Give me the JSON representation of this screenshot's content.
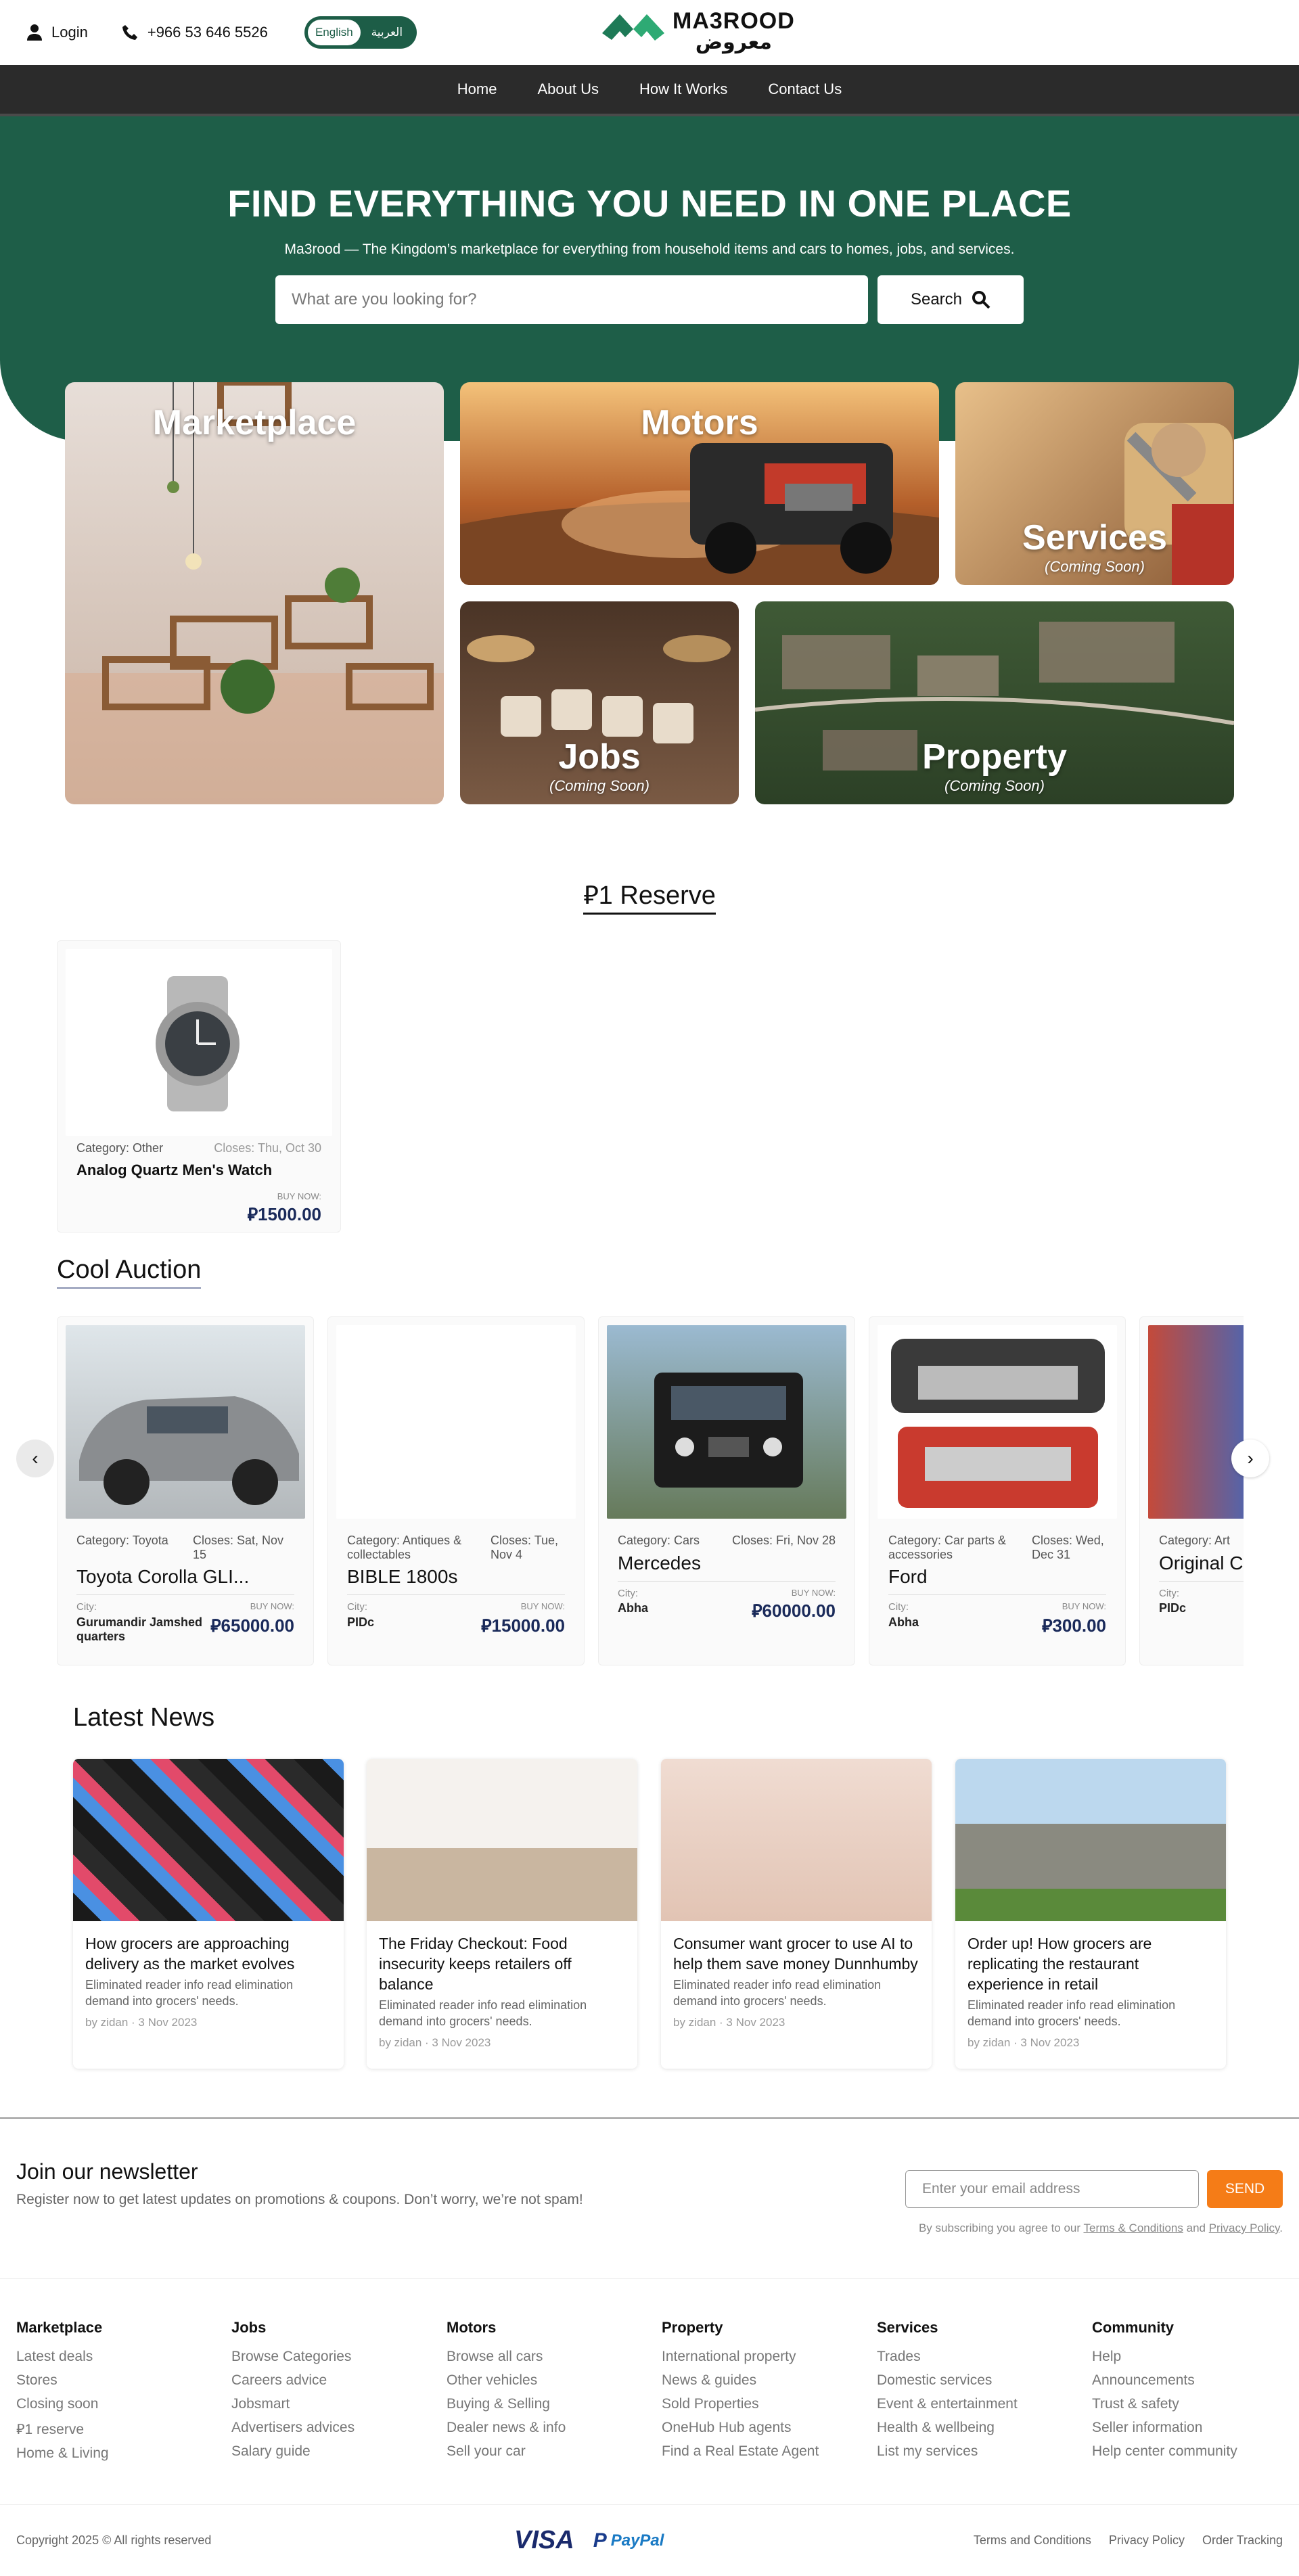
{
  "topbar": {
    "login": "Login",
    "phone": "+966 53 646 5526",
    "lang_en": "English",
    "lang_ar": "العربية",
    "logo_en": "MA3ROOD",
    "logo_ar": "معروض"
  },
  "nav": [
    "Home",
    "About Us",
    "How It Works",
    "Contact Us"
  ],
  "hero": {
    "title": "FIND EVERYTHING YOU NEED IN ONE PLACE",
    "subtitle": "Ma3rood — The Kingdom’s marketplace for everything from household items and cars to homes, jobs, and services.",
    "search_placeholder": "What are you looking for?",
    "search_button": "Search"
  },
  "categories": [
    {
      "title": "Marketplace",
      "sub": ""
    },
    {
      "title": "Motors",
      "sub": ""
    },
    {
      "title": "Services",
      "sub": "(Coming Soon)"
    },
    {
      "title": "Jobs",
      "sub": "(Coming Soon)"
    },
    {
      "title": "Property",
      "sub": "(Coming Soon)"
    }
  ],
  "currency_symbol": "⃁",
  "reserve": {
    "title": "⃁1 Reserve",
    "item": {
      "category": "Category: Other",
      "closes": "Closes: Thu, Oct 30",
      "name": "Analog Quartz Men's Watch",
      "buy_now": "BUY NOW:",
      "price": "⃁1500.00"
    }
  },
  "auction": {
    "title": "Cool Auction",
    "items": [
      {
        "category": "Category: Toyota",
        "closes": "Closes: Sat, Nov 15",
        "name": "Toyota Corolla GLI...",
        "city_label": "City:",
        "city": "Gurumandir Jamshed quarters",
        "buy_now": "BUY NOW:",
        "price": "⃁65000.00"
      },
      {
        "category": "Category: Antiques & collectables",
        "closes": "Closes: Tue, Nov 4",
        "name": "BIBLE 1800s",
        "city_label": "City:",
        "city": "PIDc",
        "buy_now": "BUY NOW:",
        "price": "⃁15000.00"
      },
      {
        "category": "Category: Cars",
        "closes": "Closes: Fri, Nov 28",
        "name": "Mercedes",
        "city_label": "City:",
        "city": "Abha",
        "buy_now": "BUY NOW:",
        "price": "⃁60000.00"
      },
      {
        "category": "Category: Car parts & accessories",
        "closes": "Closes: Wed, Dec 31",
        "name": "Ford",
        "city_label": "City:",
        "city": "Abha",
        "buy_now": "BUY NOW:",
        "price": "⃁300.00"
      },
      {
        "category": "Category: Art",
        "closes": "",
        "name": "Original C",
        "city_label": "City:",
        "city": "PIDc",
        "buy_now": "",
        "price": ""
      }
    ]
  },
  "news": {
    "title": "Latest News",
    "items": [
      {
        "title": "How grocers are approaching delivery as the market evolves",
        "desc": "Eliminated reader info read elimination demand into grocers' needs.",
        "by": "by zidan · 3 Nov 2023"
      },
      {
        "title": "The Friday Checkout: Food insecurity keeps retailers off balance",
        "desc": "Eliminated reader info read elimination demand into grocers' needs.",
        "by": "by zidan · 3 Nov 2023"
      },
      {
        "title": "Consumer want grocer to use AI to help them save money Dunnhumby",
        "desc": "Eliminated reader info read elimination demand into grocers' needs.",
        "by": "by zidan · 3 Nov 2023"
      },
      {
        "title": "Order up! How grocers are replicating the restaurant experience in retail",
        "desc": "Eliminated reader info read elimination demand into grocers' needs.",
        "by": "by zidan · 3 Nov 2023"
      }
    ]
  },
  "newsletter": {
    "title": "Join our newsletter",
    "desc": "Register now to get latest updates on promotions & coupons. Don’t worry, we’re not spam!",
    "placeholder": "Enter your email address",
    "button": "SEND",
    "terms_prefix": "By subscribing you agree to our",
    "terms_link": "Terms & Conditions",
    "and": "and",
    "privacy_link": "Privacy Policy"
  },
  "footer": {
    "cols": [
      {
        "title": "Marketplace",
        "links": [
          "Latest deals",
          "Stores",
          "Closing soon",
          "⃁1 reserve",
          "Home & Living"
        ]
      },
      {
        "title": "Jobs",
        "links": [
          "Browse Categories",
          "Careers advice",
          "Jobsmart",
          "Advertisers advices",
          "Salary guide"
        ]
      },
      {
        "title": "Motors",
        "links": [
          "Browse all cars",
          "Other vehicles",
          "Buying & Selling",
          "Dealer news & info",
          "Sell your car"
        ]
      },
      {
        "title": "Property",
        "links": [
          "International property",
          "News & guides",
          "Sold Properties",
          "OneHub Hub agents",
          "Find a Real Estate Agent"
        ]
      },
      {
        "title": "Services",
        "links": [
          "Trades",
          "Domestic services",
          "Event & entertainment",
          "Health & wellbeing",
          "List my services"
        ]
      },
      {
        "title": "Community",
        "links": [
          "Help",
          "Announcements",
          "Trust & safety",
          "Seller information",
          "Help center community"
        ]
      }
    ],
    "copyright": "Copyright 2025 © All rights reserved",
    "visa": "VISA",
    "paypal": "PayPal",
    "terms": "Terms and Conditions",
    "privacy": "Privacy Policy",
    "tracking": "Order Tracking"
  },
  "colors": {
    "brand_green": "#1e5e48",
    "nav_bg": "#2b2b2b",
    "send_orange": "#f57c17",
    "price_navy": "#1a2a5a"
  }
}
